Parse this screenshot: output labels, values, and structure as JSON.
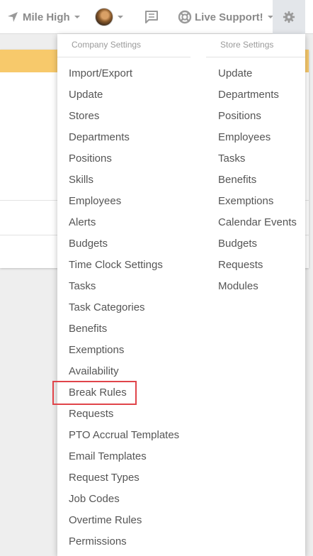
{
  "topbar": {
    "location_label": "Mile High",
    "support_label": "Live Support!",
    "icons": {
      "location": "location-arrow-icon",
      "chat": "chat-icon",
      "support": "lifebuoy-icon",
      "settings": "gear-icon"
    }
  },
  "dropdown": {
    "company_header": "Company Settings",
    "store_header": "Store Settings",
    "company_items": [
      "Import/Export",
      "Update",
      "Stores",
      "Departments",
      "Positions",
      "Skills",
      "Employees",
      "Alerts",
      "Budgets",
      "Time Clock Settings",
      "Tasks",
      "Task Categories",
      "Benefits",
      "Exemptions",
      "Availability",
      "Break Rules",
      "Requests",
      "PTO Accrual Templates",
      "Email Templates",
      "Request Types",
      "Job Codes",
      "Overtime Rules",
      "Permissions"
    ],
    "store_items": [
      "Update",
      "Departments",
      "Positions",
      "Employees",
      "Tasks",
      "Benefits",
      "Exemptions",
      "Calendar Events",
      "Budgets",
      "Requests",
      "Modules"
    ],
    "highlighted_item": "Break Rules"
  },
  "colors": {
    "highlight_border": "#e0444a",
    "banner": "#f7c96b"
  }
}
